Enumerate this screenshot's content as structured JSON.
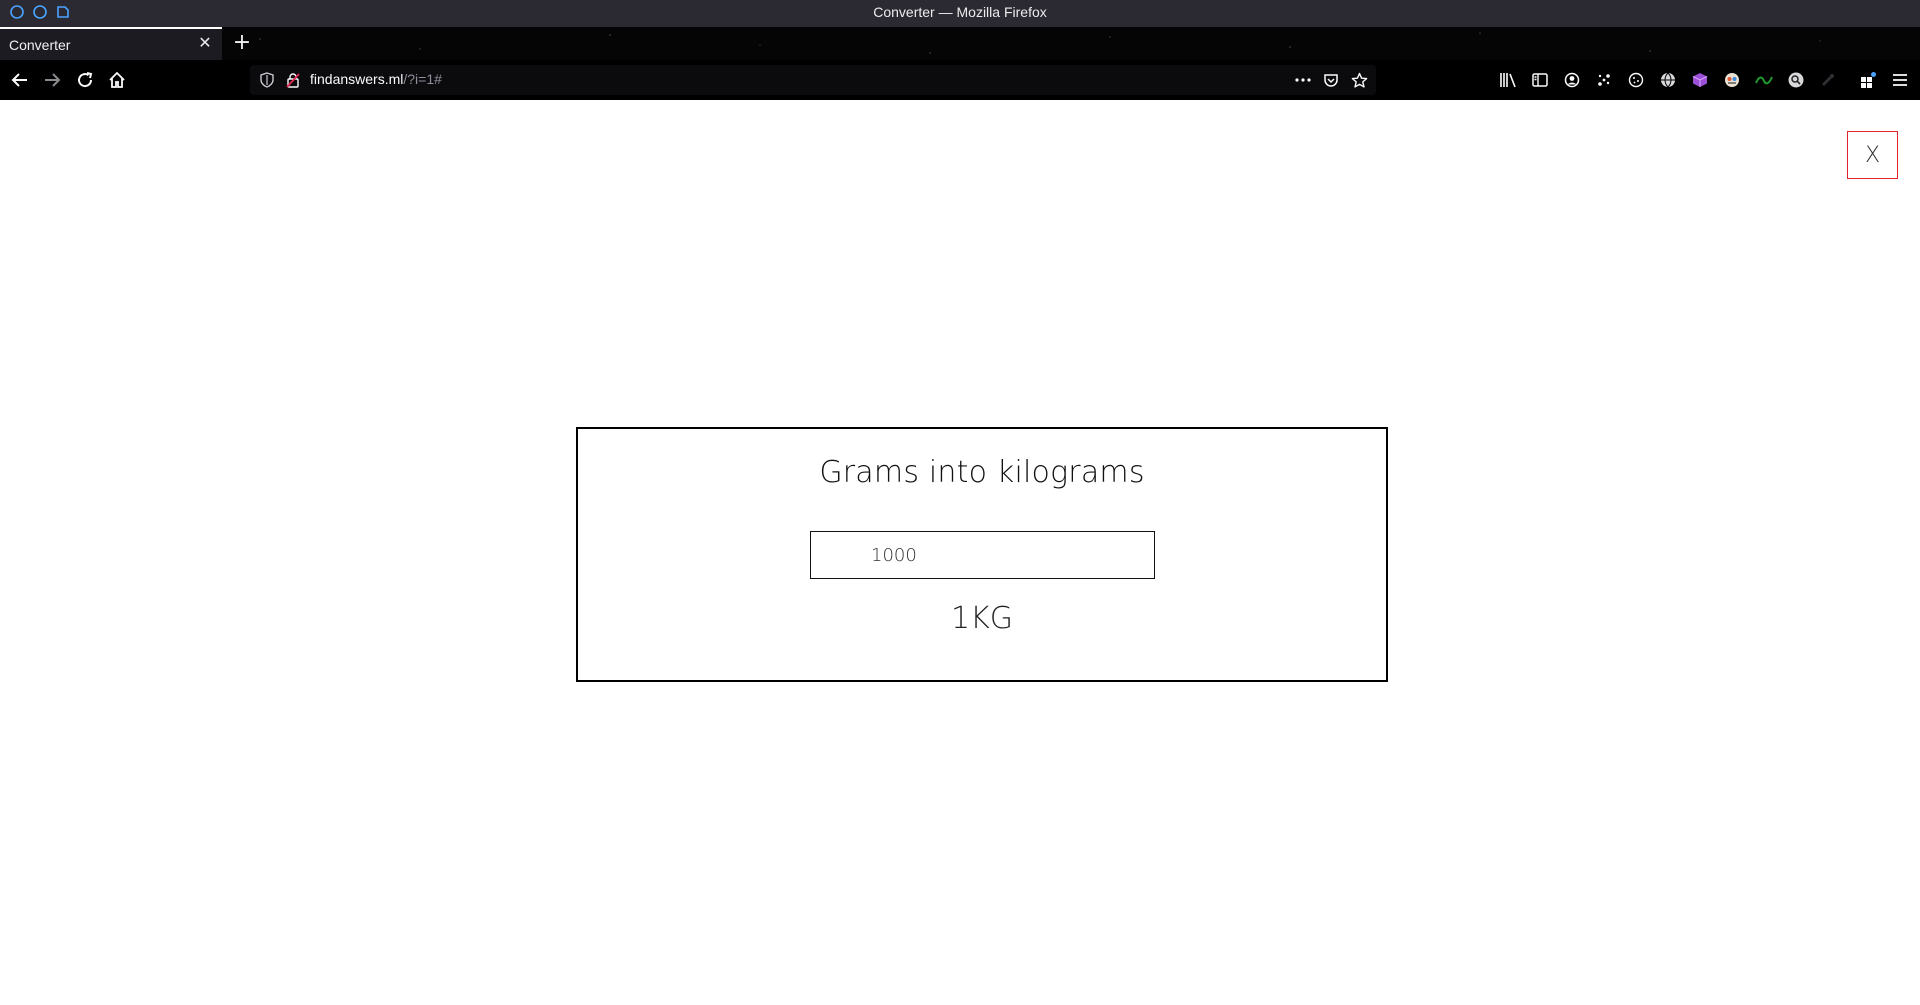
{
  "window": {
    "title": "Converter — Mozilla Firefox"
  },
  "tabs": [
    {
      "label": "Converter",
      "active": true
    }
  ],
  "toolbar": {
    "url_host": "findanswers.ml",
    "url_path": "/?i=1#",
    "icons": [
      "back-icon",
      "forward-icon",
      "reload-icon",
      "home-icon",
      "shield-icon",
      "insecure-lock-icon",
      "more-actions-icon",
      "pocket-icon",
      "bookmark-star-icon",
      "library-icon",
      "sidebar-icon",
      "account-icon",
      "extension-icon",
      "cookie-icon",
      "globe-icon",
      "cube-extension-icon",
      "colorful-extension-icon",
      "green-extension-icon",
      "search-extension-icon",
      "dark-extension-icon",
      "extensions-puzzle-icon",
      "hamburger-menu-icon"
    ]
  },
  "page": {
    "close_label": "X",
    "converter": {
      "heading": "Grams into kilograms",
      "input_value": "1000",
      "result": "1KG"
    }
  },
  "colors": {
    "close_border": "#e0262c",
    "accent_blue": "#4aa3ff"
  }
}
